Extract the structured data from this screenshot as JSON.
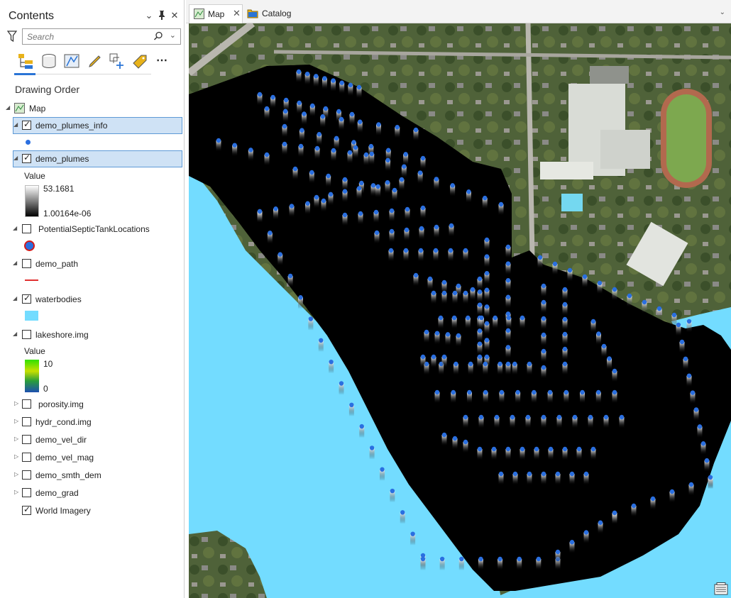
{
  "contents": {
    "title": "Contents",
    "search_placeholder": "Search",
    "drawing_order": "Drawing Order",
    "map_label": "Map",
    "layers": [
      {
        "name": "demo_plumes_info",
        "checked": true
      },
      {
        "name": "demo_plumes",
        "checked": true,
        "legend_title": "Value",
        "legend_high": "53.1681",
        "legend_low": "1.00164e-06"
      },
      {
        "name": "PotentialSepticTankLocations",
        "checked": false
      },
      {
        "name": "demo_path",
        "checked": false
      },
      {
        "name": "waterbodies",
        "checked": true
      },
      {
        "name": "lakeshore.img",
        "checked": false,
        "legend_title": "Value",
        "legend_high": "10",
        "legend_low": "0"
      },
      {
        "name": "porosity.img",
        "checked": false
      },
      {
        "name": "hydr_cond.img",
        "checked": false
      },
      {
        "name": "demo_vel_dir",
        "checked": false
      },
      {
        "name": "demo_vel_mag",
        "checked": false
      },
      {
        "name": "demo_smth_dem",
        "checked": false
      },
      {
        "name": "demo_grad",
        "checked": false
      },
      {
        "name": "World Imagery",
        "checked": true
      }
    ]
  },
  "tabs": [
    {
      "label": "Map",
      "active": true
    },
    {
      "label": "Catalog",
      "active": false
    }
  ],
  "colors": {
    "water": "#73dcff",
    "plume_dot": "#2a6fe0",
    "selection": "#cfe2f5",
    "accent": "#2a74d6"
  }
}
